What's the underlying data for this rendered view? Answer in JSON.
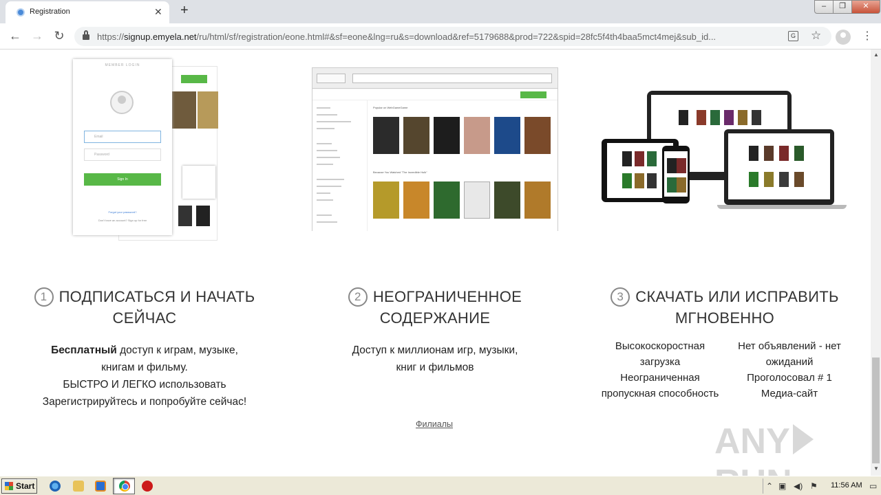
{
  "browser": {
    "tab_title": "Registration",
    "new_tab": "+",
    "url_prefix": "https://",
    "url_host": "signup.emyela.net",
    "url_rest": "/ru/html/sf/registration/eone.html#&sf=eone&lng=ru&s=download&ref=5179688&prod=722&spid=28fc5f4th4baa5mct4mej&sub_id..."
  },
  "illustrations": {
    "login": {
      "title": "MEMBER LOGIN",
      "email_placeholder": "Email",
      "password_placeholder": "Password",
      "signin_label": "Sign In",
      "forgot": "Forgot your password?",
      "no_account": "Don't have an account? Sign up for free"
    },
    "browser": {
      "popular_heading": "Popular on WebGameGame",
      "because_heading": "Because You Watched \"The Incredible Hulk\""
    }
  },
  "steps": [
    {
      "number": "1",
      "heading_line1": "ПОДПИСАТЬСЯ И НАЧАТЬ",
      "heading_line2": "СЕЙЧАС",
      "body_bold": "Бесплатный",
      "body_rest": " доступ к играм, музыке,",
      "body_line2": "книгам и фильму.",
      "body_line3": "БЫСТРО И ЛЕГКО использовать",
      "body_line4": "Зарегистрируйтесь и попробуйте сейчас!"
    },
    {
      "number": "2",
      "heading_line1": "НЕОГРАНИЧЕННОЕ",
      "heading_line2": "СОДЕРЖАНИЕ",
      "body_line1": "Доступ к миллионам игр, музыки,",
      "body_line2": "книг и фильмов"
    },
    {
      "number": "3",
      "heading_line1": "СКАЧАТЬ ИЛИ ИСПРАВИТЬ",
      "heading_line2": "МГНОВЕННО",
      "left": [
        "Высокоскоростная",
        "загрузка",
        "Неограниченная",
        "пропускная способность"
      ],
      "right": [
        "Нет объявлений - нет",
        "ожиданий",
        "Проголосовал # 1",
        "Медиа-сайт"
      ]
    }
  ],
  "footer": {
    "affiliates": "Филиалы"
  },
  "watermark": {
    "left": "ANY",
    "right": "RUN"
  },
  "taskbar": {
    "start": "Start",
    "clock": "11:56 AM"
  }
}
